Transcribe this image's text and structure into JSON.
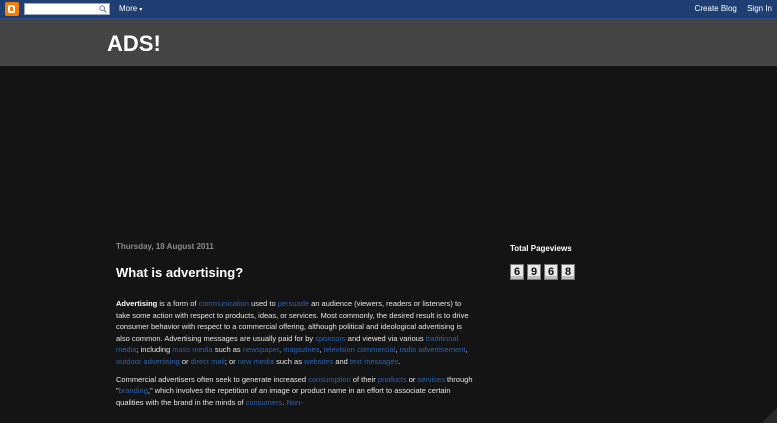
{
  "navbar": {
    "search_placeholder": "",
    "more_label": "More",
    "more_caret": "▾",
    "create_blog_label": "Create Blog",
    "sign_in_label": "Sign In",
    "bar_color": "#1f3f73",
    "logo_color": "#f57d00"
  },
  "header": {
    "title": "ADS!"
  },
  "post": {
    "date": "Thursday, 18 August 2011",
    "title": "What is advertising?",
    "p1": [
      {
        "t": "b",
        "text": "Advertising"
      },
      {
        "t": "s",
        "text": " is a form of "
      },
      {
        "t": "a",
        "text": "communication"
      },
      {
        "t": "s",
        "text": " used to "
      },
      {
        "t": "a",
        "text": "persuade"
      },
      {
        "t": "s",
        "text": " an audience (viewers, readers or listeners) to take some action with respect to products, ideas, or services. Most commonly, the desired result is to drive consumer behavior with respect to a commercial offering, although political and ideological advertising is also common. Advertising messages are usually paid for by "
      },
      {
        "t": "a",
        "text": "sponsors"
      },
      {
        "t": "s",
        "text": " and viewed via various "
      },
      {
        "t": "a",
        "text": "traditional media"
      },
      {
        "t": "s",
        "text": "; including "
      },
      {
        "t": "a",
        "text": "mass media"
      },
      {
        "t": "s",
        "text": " such as "
      },
      {
        "t": "a",
        "text": "newspaper"
      },
      {
        "t": "s",
        "text": ", "
      },
      {
        "t": "a",
        "text": "magazines"
      },
      {
        "t": "s",
        "text": ", "
      },
      {
        "t": "a",
        "text": "television commercial"
      },
      {
        "t": "s",
        "text": ", "
      },
      {
        "t": "a",
        "text": "radio advertisement"
      },
      {
        "t": "s",
        "text": ", "
      },
      {
        "t": "a",
        "text": "outdoor advertising"
      },
      {
        "t": "s",
        "text": " or "
      },
      {
        "t": "a",
        "text": "direct mail"
      },
      {
        "t": "s",
        "text": "; or "
      },
      {
        "t": "a",
        "text": "new media"
      },
      {
        "t": "s",
        "text": " such as "
      },
      {
        "t": "a",
        "text": "websites"
      },
      {
        "t": "s",
        "text": " and "
      },
      {
        "t": "a",
        "text": "text messages"
      },
      {
        "t": "s",
        "text": "."
      }
    ],
    "p2": [
      {
        "t": "s",
        "text": "Commercial advertisers often seek to generate increased "
      },
      {
        "t": "a",
        "text": "consumption"
      },
      {
        "t": "s",
        "text": " of their "
      },
      {
        "t": "a",
        "text": "products"
      },
      {
        "t": "s",
        "text": " or "
      },
      {
        "t": "a",
        "text": "services"
      },
      {
        "t": "s",
        "text": " through \""
      },
      {
        "t": "a",
        "text": "branding"
      },
      {
        "t": "s",
        "text": ",\" which involves the repetition of an image or product name in an effort to associate certain qualities with the brand in the minds of "
      },
      {
        "t": "a",
        "text": "consumers"
      },
      {
        "t": "s",
        "text": ". "
      },
      {
        "t": "a",
        "text": "Non-"
      }
    ]
  },
  "sidebar": {
    "widget_title": "Total Pageviews",
    "pageview_digits": [
      "6",
      "9",
      "6",
      "8"
    ]
  },
  "colors": {
    "background": "#141414",
    "header_bg": "#444444",
    "link": "#2a63b6"
  }
}
